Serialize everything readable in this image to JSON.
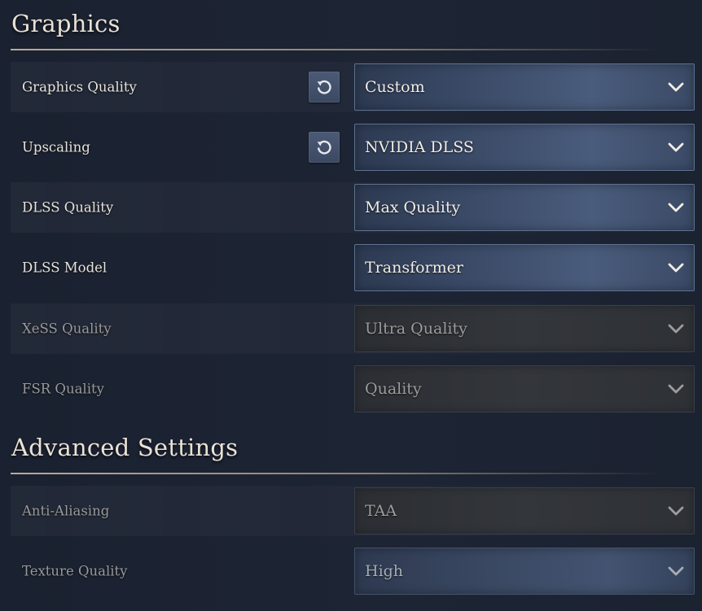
{
  "sections": {
    "graphics": {
      "title": "Graphics"
    },
    "advanced": {
      "title": "Advanced Settings"
    }
  },
  "rows": {
    "graphics_quality": {
      "label": "Graphics Quality",
      "value": "Custom"
    },
    "upscaling": {
      "label": "Upscaling",
      "value": "NVIDIA DLSS"
    },
    "dlss_quality": {
      "label": "DLSS Quality",
      "value": "Max Quality"
    },
    "dlss_model": {
      "label": "DLSS Model",
      "value": "Transformer"
    },
    "xess_quality": {
      "label": "XeSS Quality",
      "value": "Ultra Quality"
    },
    "fsr_quality": {
      "label": "FSR Quality",
      "value": "Quality"
    },
    "anti_aliasing": {
      "label": "Anti-Aliasing",
      "value": "TAA"
    },
    "texture_quality": {
      "label": "Texture Quality",
      "value": "High"
    }
  },
  "icons": {
    "reset": "reset-icon",
    "chevron": "chevron-down-icon"
  },
  "colors": {
    "background": "#1c2331",
    "dropdown_active": "#4a5c7c",
    "dropdown_disabled": "#33363b",
    "label_active": "#e8e4dc",
    "label_disabled": "#9a9a9a",
    "section_rule": "#b7ab97"
  }
}
